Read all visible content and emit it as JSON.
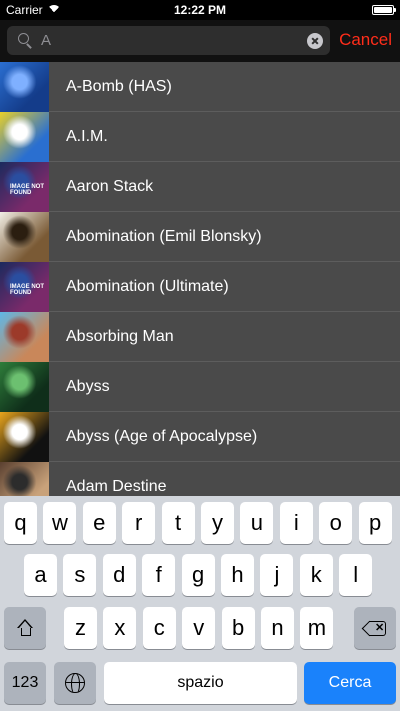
{
  "status_bar": {
    "carrier": "Carrier",
    "time": "12:22 PM",
    "battery_level": 1.0
  },
  "search": {
    "value": "A",
    "cancel_label": "Cancel"
  },
  "results": [
    {
      "name": "A-Bomb (HAS)",
      "thumb": "abomb",
      "colors": [
        "#2b6fd1",
        "#143c8a",
        "#7fb0ff"
      ]
    },
    {
      "name": "A.I.M.",
      "thumb": "aim",
      "colors": [
        "#e8d02a",
        "#2a6fd0",
        "#ffffff"
      ]
    },
    {
      "name": "Aaron Stack",
      "thumb": "not-found",
      "colors": [
        "#1b2a5e",
        "#7a2a6a",
        "#2a4ea0"
      ],
      "placeholder": "IMAGE NOT FOUND"
    },
    {
      "name": "Abomination (Emil Blonsky)",
      "thumb": "abomination",
      "colors": [
        "#f2efe6",
        "#7a5a35",
        "#2b1e10"
      ]
    },
    {
      "name": "Abomination (Ultimate)",
      "thumb": "not-found",
      "colors": [
        "#1b2a5e",
        "#7a2a6a",
        "#2a4ea0"
      ],
      "placeholder": "IMAGE NOT FOUND"
    },
    {
      "name": "Absorbing Man",
      "thumb": "absorbing",
      "colors": [
        "#5fb7e6",
        "#c9875a",
        "#9c3a2a"
      ]
    },
    {
      "name": "Abyss",
      "thumb": "abyss",
      "colors": [
        "#2e7d3a",
        "#0f2e1a",
        "#6cc070"
      ]
    },
    {
      "name": "Abyss (Age of Apocalypse)",
      "thumb": "abyss-aoa",
      "colors": [
        "#e9a51c",
        "#111111",
        "#ffffff"
      ]
    },
    {
      "name": "Adam Destine",
      "thumb": "adam",
      "colors": [
        "#5a4030",
        "#c9a27a",
        "#2c2c2c"
      ]
    }
  ],
  "keyboard": {
    "row1": [
      "q",
      "w",
      "e",
      "r",
      "t",
      "y",
      "u",
      "i",
      "o",
      "p"
    ],
    "row2": [
      "a",
      "s",
      "d",
      "f",
      "g",
      "h",
      "j",
      "k",
      "l"
    ],
    "row3": [
      "z",
      "x",
      "c",
      "v",
      "b",
      "n",
      "m"
    ],
    "numbers_label": "123",
    "space_label": "spazio",
    "return_label": "Cerca",
    "shift_icon": "shift-icon",
    "backspace_icon": "backspace-icon",
    "globe_icon": "globe-icon"
  },
  "colors": {
    "cancel": "#ff2d1a",
    "return_key": "#1a82fb",
    "row_bg": "#4a4a4a"
  }
}
